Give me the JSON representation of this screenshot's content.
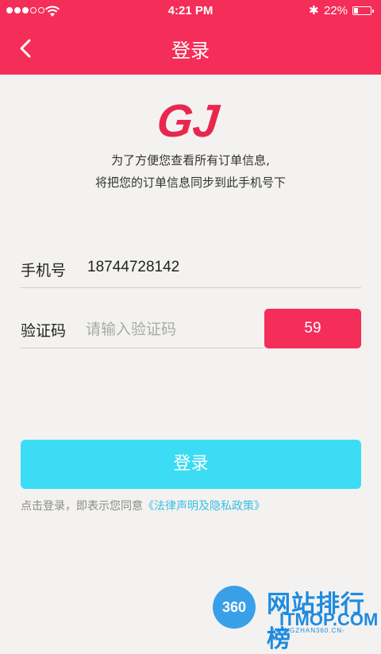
{
  "status_bar": {
    "time": "4:21 PM",
    "battery_text": "22%",
    "battery_level": 0.22
  },
  "navbar": {
    "title": "登录",
    "back_icon": "chevron-left-icon"
  },
  "logo": {
    "text": "GJ",
    "color": "#e8274f"
  },
  "intro": {
    "line1": "为了方便您查看所有订单信息,",
    "line2": "将把您的订单信息同步到此手机号下"
  },
  "form": {
    "phone_label": "手机号",
    "phone_value": "18744728142",
    "code_label": "验证码",
    "code_placeholder": "请输入验证码",
    "countdown": "59"
  },
  "login_button": "登录",
  "agreement": {
    "prefix": "点击登录，即表示您同意",
    "link": "《法律声明及隐私政策》"
  },
  "watermark": {
    "circle": "360",
    "cn": "网站排行榜",
    "en": "ITMOP.COM",
    "sub": "-WANGZHAN360.CN-"
  },
  "colors": {
    "brand": "#f52d59",
    "button": "#3cdcf4",
    "link": "#37bfe6",
    "background": "#f3f2f0"
  }
}
